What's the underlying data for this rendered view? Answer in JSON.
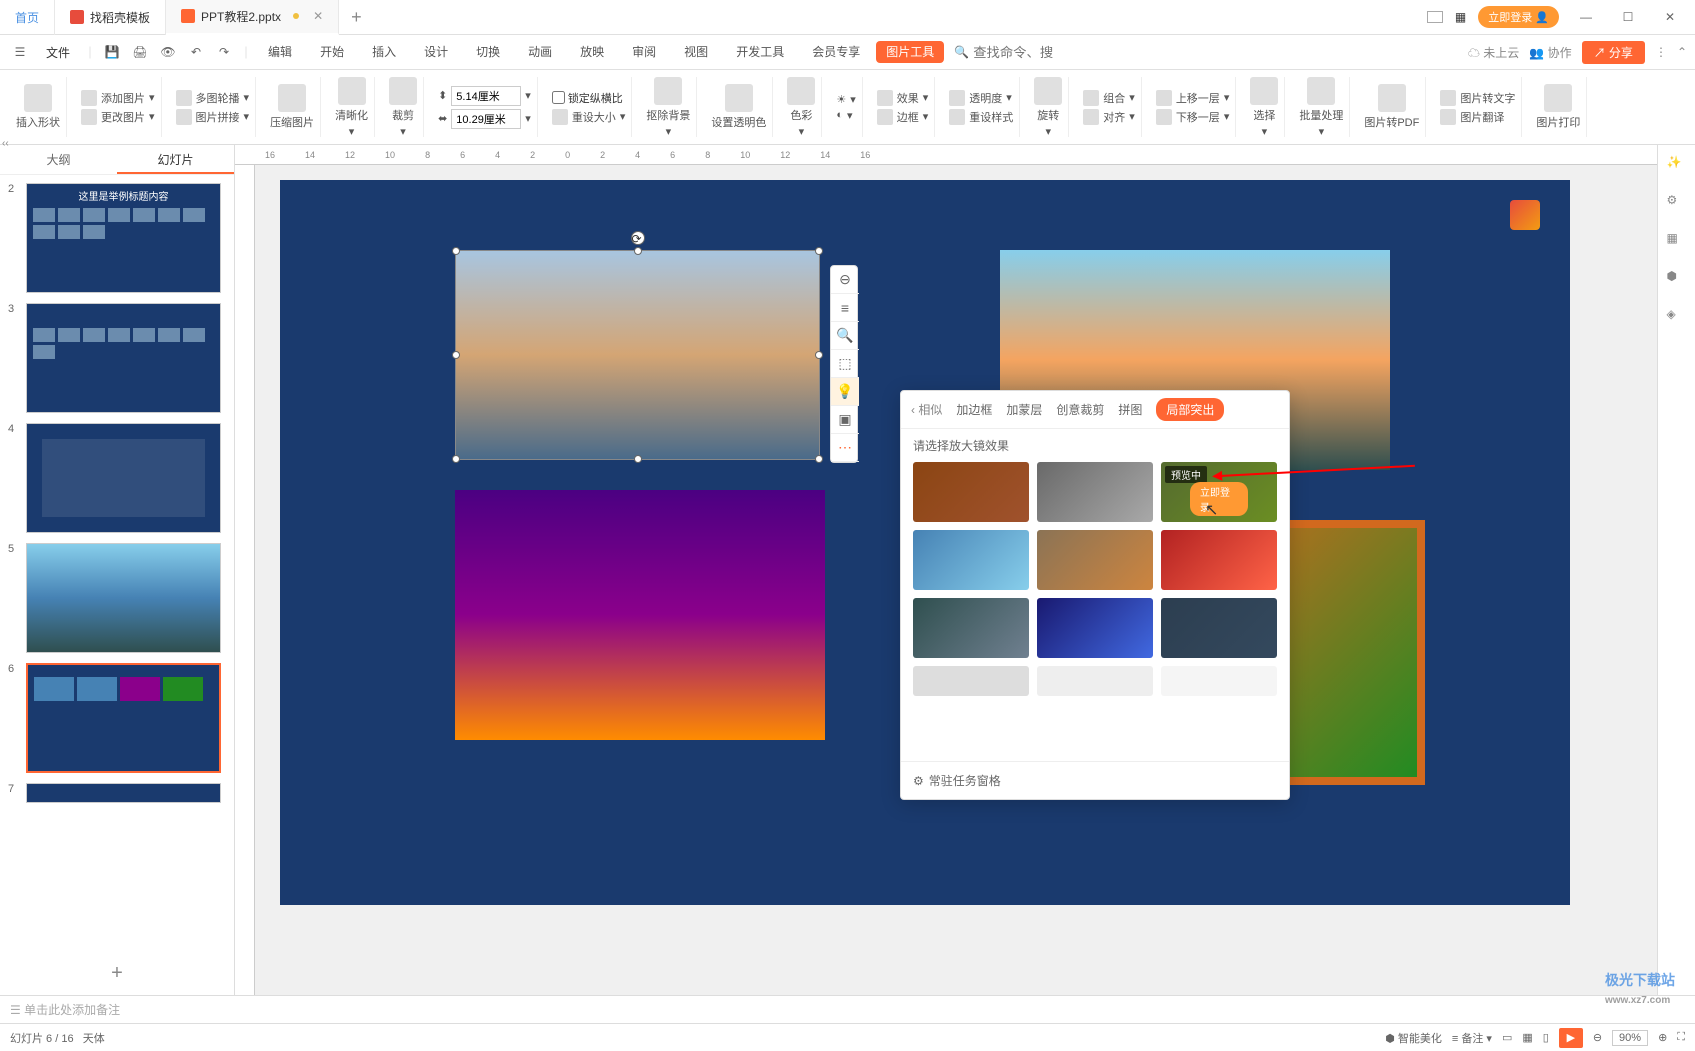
{
  "titlebar": {
    "home": "首页",
    "tab1": "找稻壳模板",
    "tab2": "PPT教程2.pptx",
    "login": "立即登录"
  },
  "menubar": {
    "file": "文件",
    "edit": "编辑",
    "tabs": [
      "开始",
      "插入",
      "设计",
      "切换",
      "动画",
      "放映",
      "审阅",
      "视图",
      "开发工具",
      "会员专享"
    ],
    "pictools": "图片工具",
    "search_cmd": "查找命令、搜索模板",
    "cloud": "未上云",
    "coop": "协作",
    "share": "分享"
  },
  "ribbon": {
    "insert_shape": "插入形状",
    "add_image": "添加图片",
    "multi_outline": "多图轮播",
    "change_image": "更改图片",
    "image_tile": "图片拼接",
    "compress": "压缩图片",
    "clarity": "清晰化",
    "crop": "裁剪",
    "width": "5.14厘米",
    "height": "10.29厘米",
    "lock_ratio": "锁定纵横比",
    "reset_size": "重设大小",
    "remove_bg": "抠除背景",
    "set_transparent": "设置透明色",
    "color": "色彩",
    "effect": "效果",
    "transparency": "透明度",
    "border": "边框",
    "reset_style": "重设样式",
    "rotate": "旋转",
    "align": "对齐",
    "combine": "组合",
    "up_layer": "上移一层",
    "down_layer": "下移一层",
    "select": "选择",
    "batch": "批量处理",
    "to_pdf": "图片转PDF",
    "to_text": "图片转文字",
    "translate": "图片翻译",
    "print": "图片打印"
  },
  "panel": {
    "outline": "大纲",
    "slides": "幻灯片",
    "slide2_title": "这里是举例标题内容"
  },
  "slides_visible": [
    2,
    3,
    4,
    5,
    6,
    7
  ],
  "popup": {
    "back": "相似",
    "tabs": [
      "加边框",
      "加蒙层",
      "创意裁剪",
      "拼图"
    ],
    "active_tab": "局部突出",
    "subtitle": "请选择放大镜效果",
    "preview_label": "预览中",
    "login_now": "立即登录",
    "footer": "常驻任务窗格"
  },
  "notes": "单击此处添加备注",
  "status": {
    "slide_pos": "幻灯片 6 / 16",
    "theme": "天体",
    "beautify": "智能美化",
    "notes_btn": "备注",
    "zoom": "90%"
  },
  "watermark": "极光下载站",
  "watermark_url": "www.xz7.com"
}
